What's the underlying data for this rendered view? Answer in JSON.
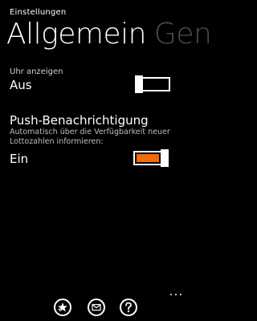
{
  "app_title": "Einstellungen",
  "pivot": {
    "active": "Allgemein",
    "next": "Gen"
  },
  "clock_setting": {
    "label": "Uhr anzeigen",
    "value": "Aus",
    "enabled": false
  },
  "push_setting": {
    "title": "Push-Benachrichtigung",
    "description": "Automatisch über die Verfügbarkeit neuer Lottozahlen informieren:",
    "value": "Ein",
    "enabled": true
  },
  "colors": {
    "background": "#000000",
    "accent": "#f06a0f",
    "text": "#ffffff",
    "inactive_pivot": "#4d4d4d"
  },
  "app_bar": {
    "buttons": [
      {
        "icon": "star-plus-icon"
      },
      {
        "icon": "mail-icon"
      },
      {
        "icon": "help-icon"
      }
    ],
    "more_icon": "more-dots-icon"
  }
}
